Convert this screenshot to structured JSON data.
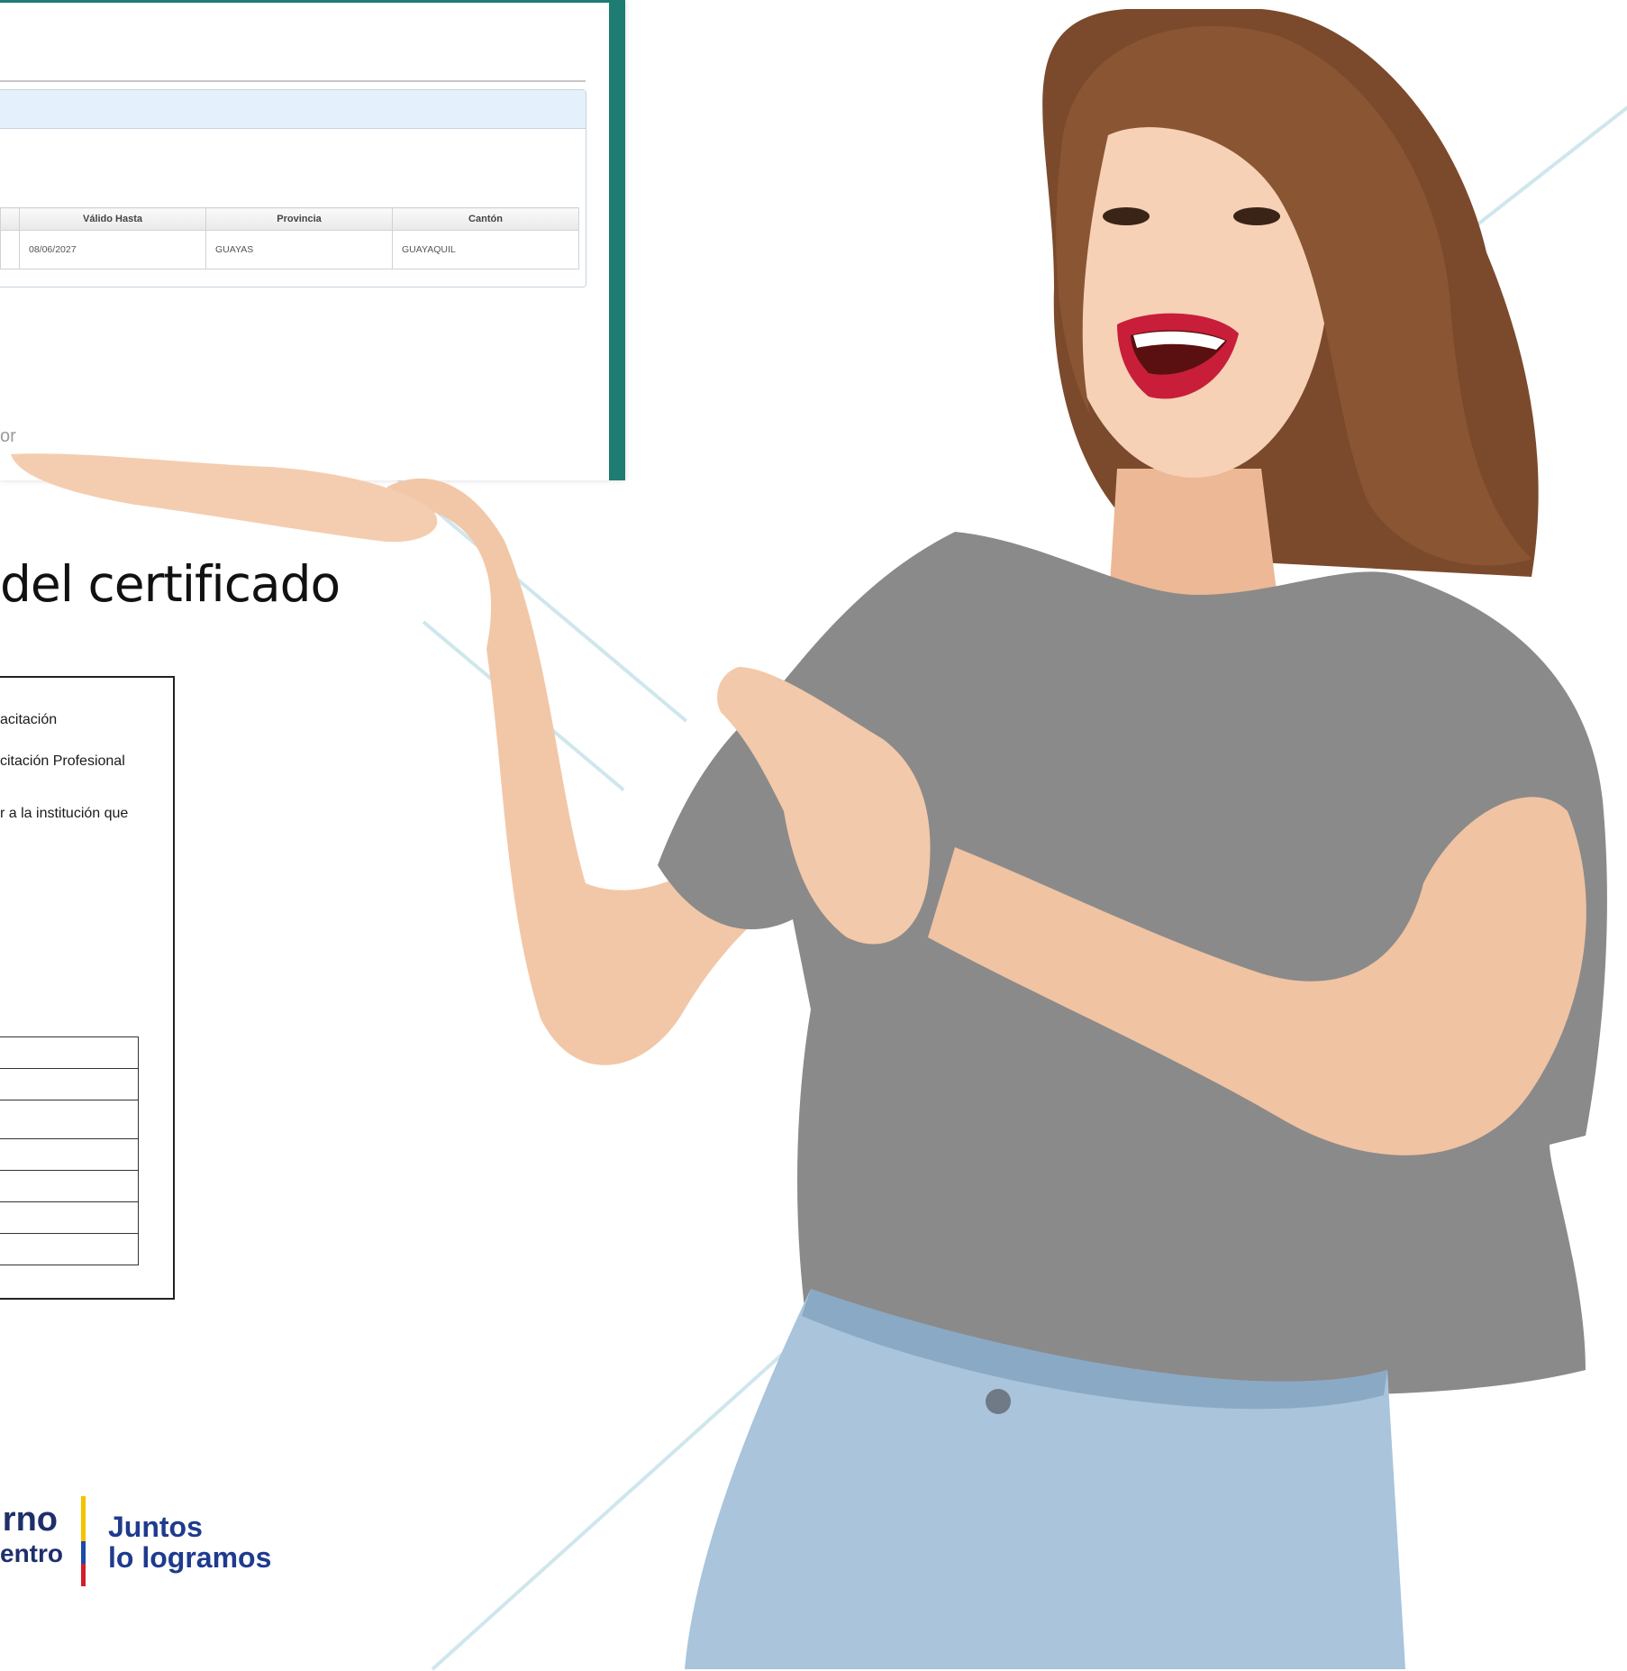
{
  "screenshot": {
    "table_headers": [
      "Válido Hasta",
      "Provincia",
      "Cantón"
    ],
    "table_row": [
      "08/06/2027",
      "GUAYAS",
      "GUAYAQUIL"
    ],
    "footer_fragment": "or"
  },
  "headline": "del certificado",
  "document": {
    "lines": [
      "acitación",
      "citación Profesional",
      "r a la institución que"
    ]
  },
  "brand": {
    "gov_line1": "rno",
    "gov_line2": "entro",
    "slogan_line1": "Juntos",
    "slogan_line2": "lo logramos"
  },
  "colors": {
    "teal_frame": "#1e7c72",
    "panel_header": "#e4f1fc",
    "brand_navy": "#1f3b8f",
    "shirt_gray": "#8a8a8a",
    "jeans_blue": "#a9c4db"
  }
}
